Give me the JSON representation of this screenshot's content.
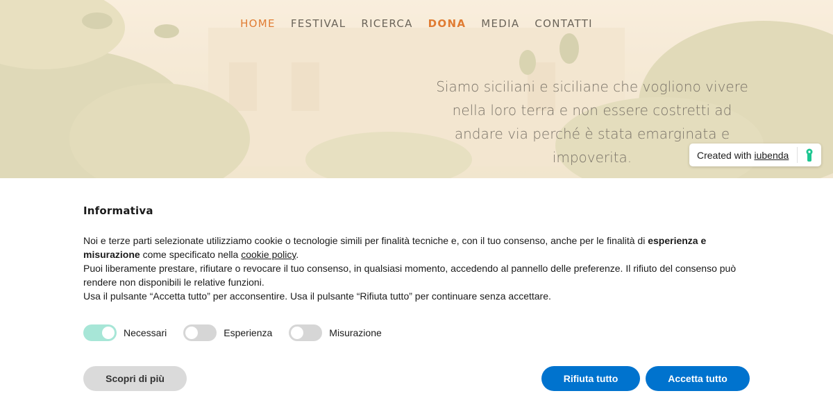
{
  "nav": {
    "items": [
      {
        "label": "HOME"
      },
      {
        "label": "FESTIVAL"
      },
      {
        "label": "RICERCA"
      },
      {
        "label": "DONA"
      },
      {
        "label": "MEDIA"
      },
      {
        "label": "CONTATTI"
      }
    ],
    "active": "HOME",
    "accent_color": "#e07c33"
  },
  "hero": {
    "text_lines": [
      "Siamo siciliani e siciliane che vogliono vivere",
      "nella loro terra e non essere costretti ad",
      "andare via perché è stata emarginata e",
      "impoverita."
    ]
  },
  "iubenda_badge": {
    "prefix": "Created with",
    "link": "iubenda",
    "icon": "iubenda-keyhole-icon",
    "icon_color": "#1cc691"
  },
  "cookie_banner": {
    "title": "Informativa",
    "p1_a": "Noi e terze parti selezionate utilizziamo cookie o tecnologie simili per finalità tecniche e, con il tuo consenso, anche per le finalità di ",
    "p1_bold": "esperienza e misurazione",
    "p1_b": " come specificato nella ",
    "p1_link": "cookie policy",
    "p1_c": ".",
    "p2": "Puoi liberamente prestare, rifiutare o revocare il tuo consenso, in qualsiasi momento, accedendo al pannello delle preferenze. Il rifiuto del consenso può rendere non disponibili le relative funzioni.",
    "p3": "Usa il pulsante “Accetta tutto” per acconsentire. Usa il pulsante “Rifiuta tutto” per continuare senza accettare.",
    "toggles": [
      {
        "label": "Necessari",
        "on": true
      },
      {
        "label": "Esperienza",
        "on": false
      },
      {
        "label": "Misurazione",
        "on": false
      }
    ],
    "buttons": {
      "more": "Scopri di più",
      "reject": "Rifiuta tutto",
      "accept": "Accetta tutto"
    },
    "button_color": "#0073ce"
  }
}
